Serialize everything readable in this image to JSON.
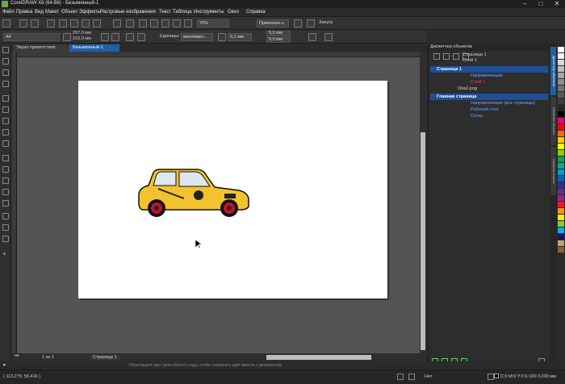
{
  "window": {
    "title": "CorelDRAW X8 (64-Bit) - Безымянный-1"
  },
  "menu": [
    "Файл",
    "Правка",
    "Вид",
    "Макет",
    "Объект",
    "Эффекты",
    "Растровые изображения",
    "Текст",
    "Таблица",
    "Инструменты",
    "Окно",
    "Справка"
  ],
  "toolbar1": {
    "zoom": "75%",
    "snap": "Привязать к",
    "launch": "Запуск"
  },
  "toolbar2": {
    "page_size": "A4",
    "width": "297,0 мм",
    "height": "210,0 мм",
    "units_label": "Единицы:",
    "units": "миллимет...",
    "nudge": "0,1 мм",
    "dup_x": "5,0 мм",
    "dup_y": "5,0 мм"
  },
  "tabs": [
    "Экран приветствия",
    "Безымянный-1"
  ],
  "pagebar": {
    "page_of": "1 из 1",
    "page_tab": "Страница 1"
  },
  "status": {
    "coords": "( 113,275; 55,416 )",
    "hint": "Перетащите цвет (или объект) сюда, чтобы сохранить цвет вместе с документом",
    "fill_none": "Нет",
    "fill_info": "C:0 M:0 Y:0 K:100 0,200 мм"
  },
  "docker": {
    "title": "Диспетчер объектов",
    "header_page": "Страница 1",
    "header_layer": "Слой 1",
    "rows": [
      {
        "label": "Страница 1",
        "type": "page"
      },
      {
        "label": "Направляющие",
        "type": "layer"
      },
      {
        "label": "Слой 1",
        "type": "layer"
      },
      {
        "label": "Oka2.png",
        "type": "object"
      },
      {
        "label": "Главная страница",
        "type": "page"
      },
      {
        "label": "Направляющие (все страницы)",
        "type": "layer"
      },
      {
        "label": "Рабочий стол",
        "type": "layer"
      },
      {
        "label": "Сетка",
        "type": "layer"
      }
    ]
  },
  "side_tabs": [
    "Диспетчер объектов",
    "Свойства объекта",
    "Свойства текста"
  ],
  "palette": [
    "#ffffff",
    "#f2f2f2",
    "#d9d9d9",
    "#bfbfbf",
    "#a6a6a6",
    "#8c8c8c",
    "#737373",
    "#595959",
    "#404040",
    "#262626",
    "#000000",
    "#e6007e",
    "#ff0000",
    "#ff6a00",
    "#ffcc00",
    "#ffff00",
    "#99cc00",
    "#00a650",
    "#00a99d",
    "#0099cc",
    "#0066b3",
    "#2e3192",
    "#662d91",
    "#92278f",
    "#ed1c24",
    "#f7941d",
    "#fff200",
    "#8dc63f",
    "#00aeef",
    "#1b1464",
    "#c1a36f",
    "#8b5e3c"
  ],
  "colors": {
    "accent": "#1f5fa8",
    "selection": "#1f4f95"
  }
}
